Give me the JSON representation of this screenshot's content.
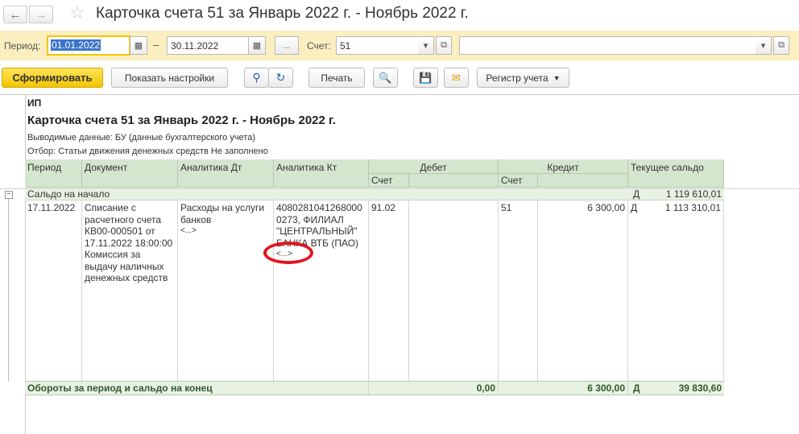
{
  "window": {
    "title": "Карточка счета 51 за Январь 2022 г. - Ноябрь 2022 г."
  },
  "period": {
    "label": "Период:",
    "from": "01.01.2022",
    "to": "30.11.2022",
    "dash": "–",
    "more_label": "...",
    "account_label": "Счет:",
    "account_value": "51",
    "org_value": ""
  },
  "toolbar": {
    "generate_label": "Сформировать",
    "settings_label": "Показать настройки",
    "print_label": "Печать",
    "registry_label": "Регистр учета"
  },
  "report": {
    "org": "ИП",
    "title": "Карточка счета 51 за Январь 2022 г. - Ноябрь 2022 г.",
    "displayed_data": "Выводимые данные: БУ (данные бухгалтерского учета)",
    "filter": "Отбор: Статьи движения денежных средств Не заполнено",
    "headers": {
      "period": "Период",
      "document": "Документ",
      "analytics_dt": "Аналитика Дт",
      "analytics_kt": "Аналитика Кт",
      "debit": "Дебет",
      "credit": "Кредит",
      "balance": "Текущее сальдо",
      "account": "Счет"
    },
    "opening": {
      "label": "Сальдо на начало",
      "side": "Д",
      "value": "1 119 610,01"
    },
    "row": {
      "date": "17.11.2022",
      "document": [
        "Списание с",
        "расчетного счета",
        "КВ00-000501 от",
        "17.11.2022 18:00:00",
        "Комиссия за",
        "выдачу наличных",
        "денежных средств"
      ],
      "analytics_dt": [
        "Расходы на услуги",
        "банков",
        "<...>"
      ],
      "analytics_kt": [
        "4080281041268000",
        "0273, ФИЛИАЛ",
        "\"ЦЕНТРАЛЬНЫЙ\"",
        "БАНКА ВТБ (ПАО)",
        "<...>"
      ],
      "debit_account": "91.02",
      "credit_account": "51",
      "credit_value": "6 300,00",
      "balance_side": "Д",
      "balance_value": "1 113 310,01"
    },
    "totals": {
      "label": "Обороты за период и сальдо на конец",
      "debit": "0,00",
      "credit": "6 300,00",
      "side": "Д",
      "balance": "39 830,60"
    }
  }
}
